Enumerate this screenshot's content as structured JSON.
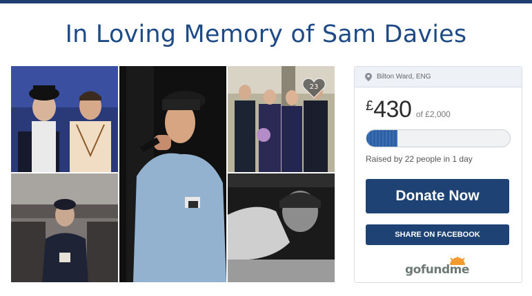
{
  "page": {
    "title": "In Loving Memory of Sam Davies",
    "accent": "#1e4a86"
  },
  "gallery": {
    "photo_count": "23",
    "photos": [
      {
        "name": "two friends in hats"
      },
      {
        "name": "performer with microphone"
      },
      {
        "name": "wedding group"
      },
      {
        "name": "seated young man with cup"
      },
      {
        "name": "sleeping young man black and white"
      }
    ]
  },
  "campaign": {
    "location": "Bilton Ward, ENG",
    "currency": "£",
    "raised_amount": "430",
    "goal_text": "of £2,000",
    "progress_fraction": 0.215,
    "raised_by": "Raised by 22 people in 1 day",
    "donate_label": "Donate Now",
    "share_label": "SHARE ON FACEBOOK",
    "brand": "gofundme",
    "button_color": "#1d4273"
  }
}
